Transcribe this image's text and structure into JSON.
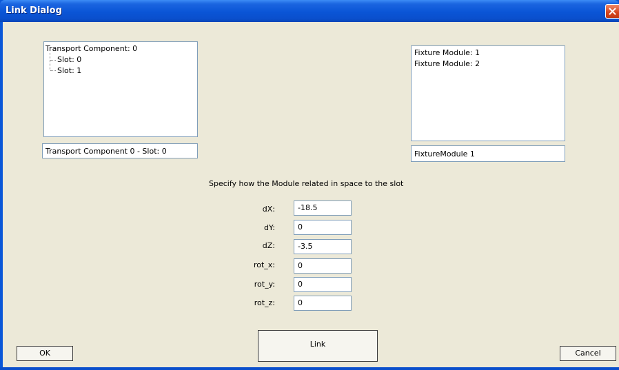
{
  "window": {
    "title": "Link Dialog"
  },
  "transport_tree": {
    "root": "Transport Component: 0",
    "children": [
      "Slot: 0",
      "Slot: 1"
    ]
  },
  "transport_selection": "Transport Component 0 - Slot: 0",
  "fixture_list": {
    "items": [
      "Fixture Module: 1",
      "Fixture Module: 2"
    ]
  },
  "fixture_selection": "FixtureModule 1",
  "instruction": "Specify how the Module related in space to the slot",
  "params": [
    {
      "label": "dX:",
      "value": "-18.5"
    },
    {
      "label": "dY:",
      "value": "0"
    },
    {
      "label": "dZ:",
      "value": "-3.5"
    },
    {
      "label": "rot_x:",
      "value": "0"
    },
    {
      "label": "rot_y:",
      "value": "0"
    },
    {
      "label": "rot_z:",
      "value": "0"
    }
  ],
  "buttons": {
    "ok": "OK",
    "link": "Link",
    "cancel": "Cancel"
  },
  "icons": {
    "close": "close-icon"
  }
}
